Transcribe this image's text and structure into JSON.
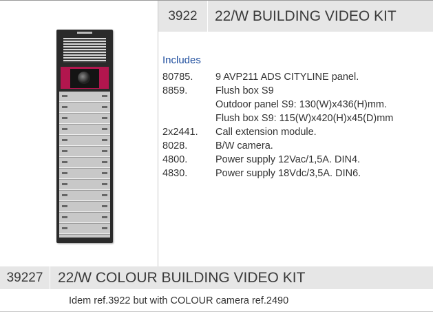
{
  "kit1": {
    "ref": "3922",
    "title": "22/W BUILDING VIDEO KIT",
    "includes_label": "Includes",
    "items": [
      {
        "code": "80785.",
        "desc": "9 AVP211 ADS CITYLINE panel."
      },
      {
        "code": "8859.",
        "desc": "Flush box S9"
      },
      {
        "code": "",
        "desc": "Outdoor panel S9: 130(W)x436(H)mm."
      },
      {
        "code": "",
        "desc": "Flush box S9: 115(W)x420(H)x45(D)mm"
      },
      {
        "code": "2x2441.",
        "desc": "Call extension module."
      },
      {
        "code": "8028.",
        "desc": "B/W camera."
      },
      {
        "code": "4800.",
        "desc": "Power supply 12Vac/1,5A. DIN4."
      },
      {
        "code": "4830.",
        "desc": "Power supply 18Vdc/3,5A. DIN6."
      }
    ]
  },
  "kit2": {
    "ref": "39227",
    "title": "22/W COLOUR BUILDING VIDEO KIT",
    "note": "Idem ref.3922 but with COLOUR camera ref.2490"
  },
  "image": {
    "icon": "intercom-panel-photo"
  }
}
